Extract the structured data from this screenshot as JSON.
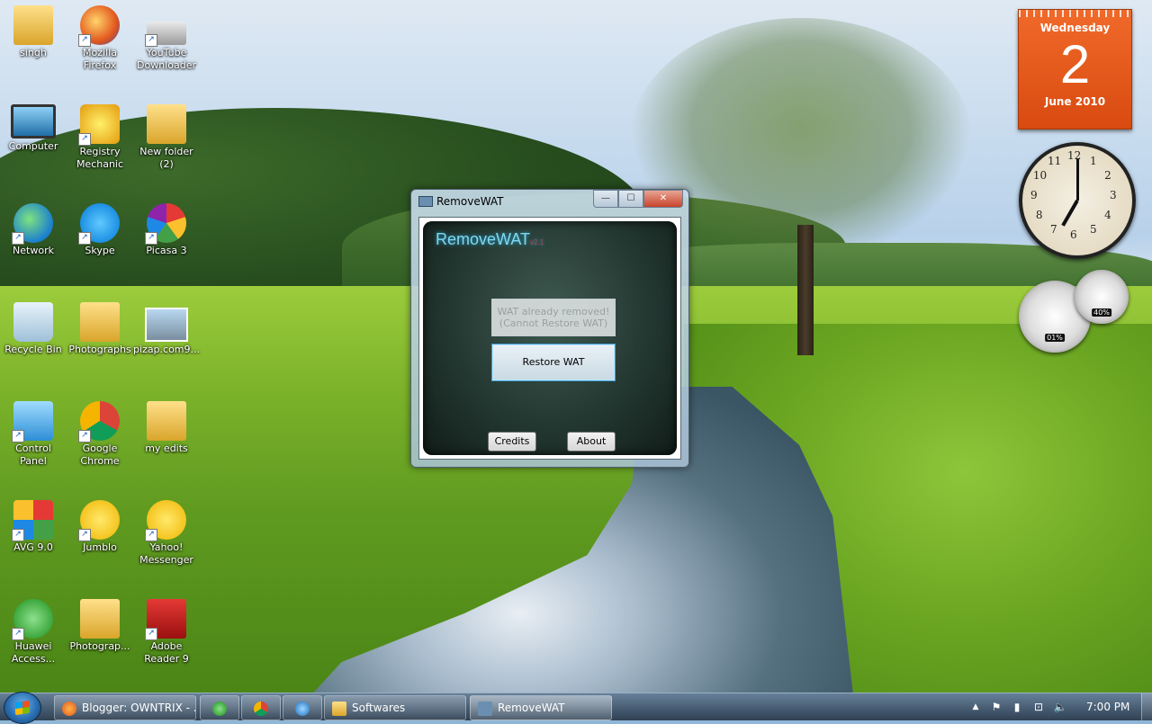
{
  "desktop": {
    "icons": [
      {
        "label": "singh",
        "icon": "user-folder-icon"
      },
      {
        "label": "Mozilla\nFirefox",
        "icon": "firefox-icon"
      },
      {
        "label": "YouTube\nDownloader",
        "icon": "youtube-downloader-icon"
      },
      {
        "label": "Computer",
        "icon": "computer-icon"
      },
      {
        "label": "Registry\nMechanic",
        "icon": "registry-mechanic-icon"
      },
      {
        "label": "New folder\n(2)",
        "icon": "folder-icon"
      },
      {
        "label": "Network",
        "icon": "network-icon"
      },
      {
        "label": "Skype",
        "icon": "skype-icon"
      },
      {
        "label": "Picasa 3",
        "icon": "picasa-icon"
      },
      {
        "label": "Recycle Bin",
        "icon": "recycle-bin-icon"
      },
      {
        "label": "Photographs",
        "icon": "folder-icon"
      },
      {
        "label": "pizap.com9...",
        "icon": "image-file-icon"
      },
      {
        "label": "Control\nPanel",
        "icon": "control-panel-icon"
      },
      {
        "label": "Google\nChrome",
        "icon": "chrome-icon"
      },
      {
        "label": "my edits",
        "icon": "folder-icon"
      },
      {
        "label": "AVG 9.0",
        "icon": "avg-icon"
      },
      {
        "label": "Jumblo",
        "icon": "jumblo-icon"
      },
      {
        "label": "Yahoo!\nMessenger",
        "icon": "yahoo-messenger-icon"
      },
      {
        "label": "Huawei\nAccess...",
        "icon": "huawei-icon"
      },
      {
        "label": "Photograp...",
        "icon": "folder-icon"
      },
      {
        "label": "Adobe\nReader 9",
        "icon": "adobe-reader-icon"
      }
    ]
  },
  "gadgets": {
    "calendar": {
      "weekday": "Wednesday",
      "day": "2",
      "month_year": "June 2010"
    },
    "clock": {
      "numerals": [
        "12",
        "1",
        "2",
        "3",
        "4",
        "5",
        "6",
        "7",
        "8",
        "9",
        "10",
        "11"
      ]
    },
    "cpu_meter": {
      "cpu_value": "01%",
      "memory_value": "40%"
    }
  },
  "window": {
    "title": "RemoveWAT",
    "app_name": "RemoveWAT",
    "app_version": "v2.1",
    "status_button": {
      "line1": "WAT already removed!",
      "line2": "(Cannot Restore WAT)"
    },
    "restore_button": "Restore WAT",
    "credits_button": "Credits",
    "about_button": "About",
    "min_glyph": "—",
    "max_glyph": "☐",
    "close_glyph": "✕"
  },
  "taskbar": {
    "items": [
      {
        "label": "Blogger: OWNTRIX - ...",
        "icon": "firefox-icon"
      },
      {
        "label": "",
        "icon": "green-app-icon"
      },
      {
        "label": "",
        "icon": "chrome-icon"
      },
      {
        "label": "",
        "icon": "ie-icon"
      },
      {
        "label": "Softwares",
        "icon": "folder-icon"
      },
      {
        "label": "RemoveWAT",
        "icon": "removewat-icon"
      }
    ],
    "time": "7:00 PM",
    "tray_glyphs": {
      "arrow": "▲",
      "flag": "⚑",
      "battery": "▮",
      "network": "⊡",
      "volume": "🔈"
    }
  },
  "colors": {
    "calendar_bg": "#e85a1a",
    "app_title": "#7fd8f0",
    "taskbar": "#2d3e50"
  }
}
